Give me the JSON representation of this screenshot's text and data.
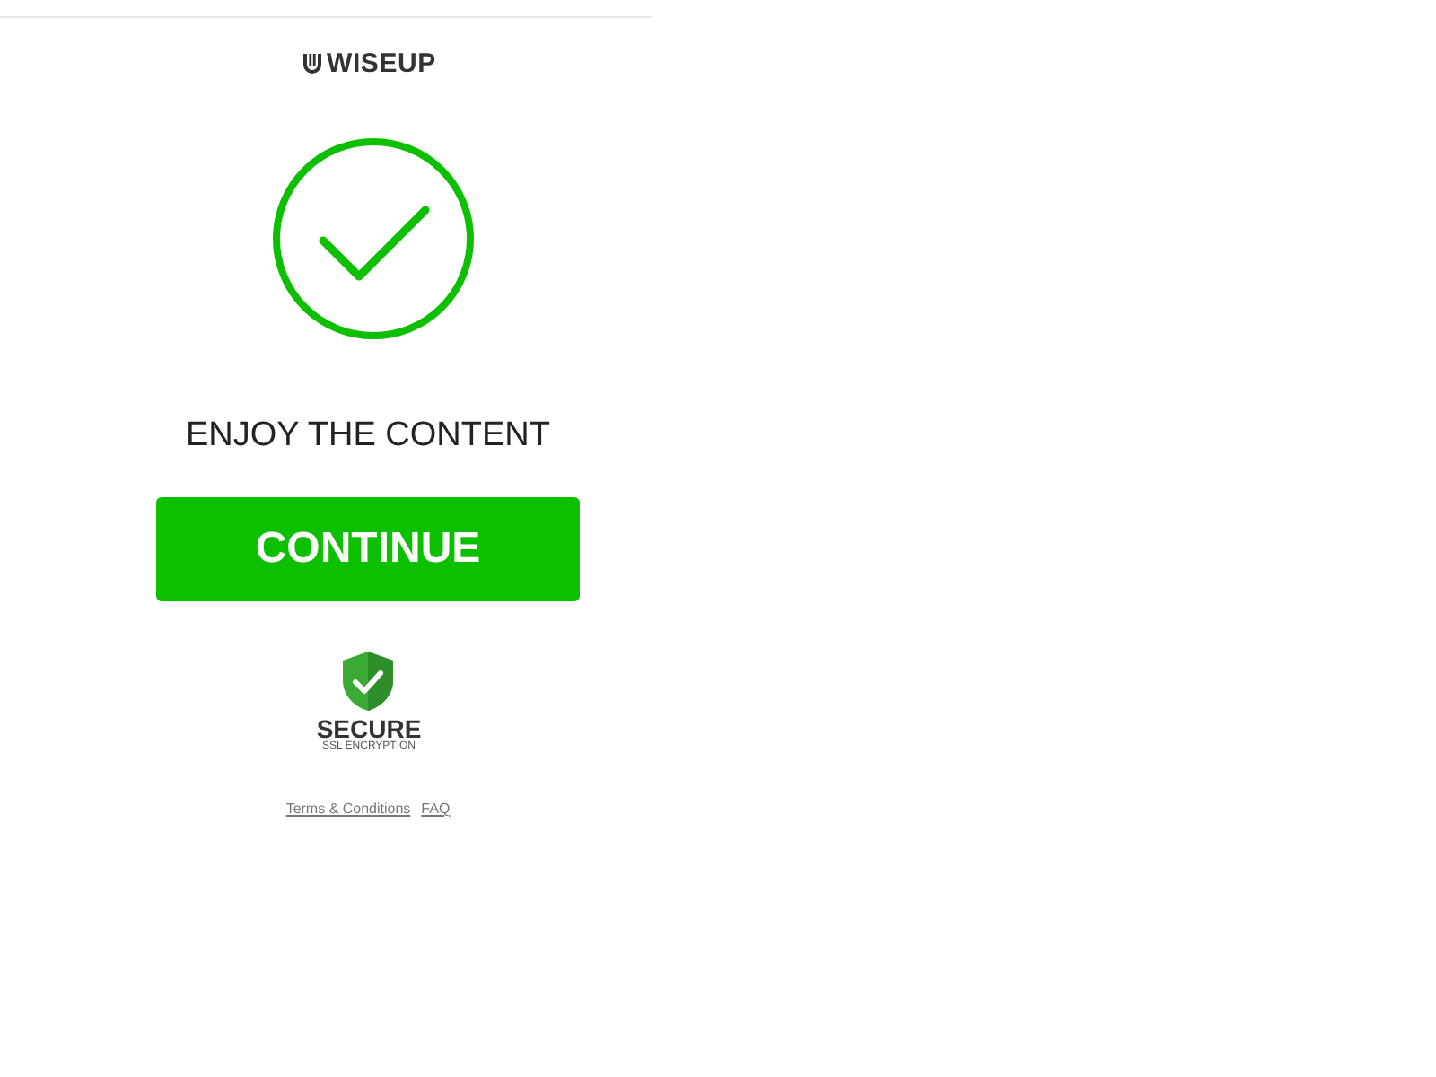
{
  "logo": {
    "text": "WISEUP"
  },
  "status": {
    "kind": "success"
  },
  "message": "ENJOY THE CONTENT",
  "button": {
    "label": "CONTINUE"
  },
  "badge": {
    "title": "SECURE",
    "subtitle": "SSL ENCRYPTION"
  },
  "links": [
    "Terms & Conditions",
    "FAQ"
  ]
}
